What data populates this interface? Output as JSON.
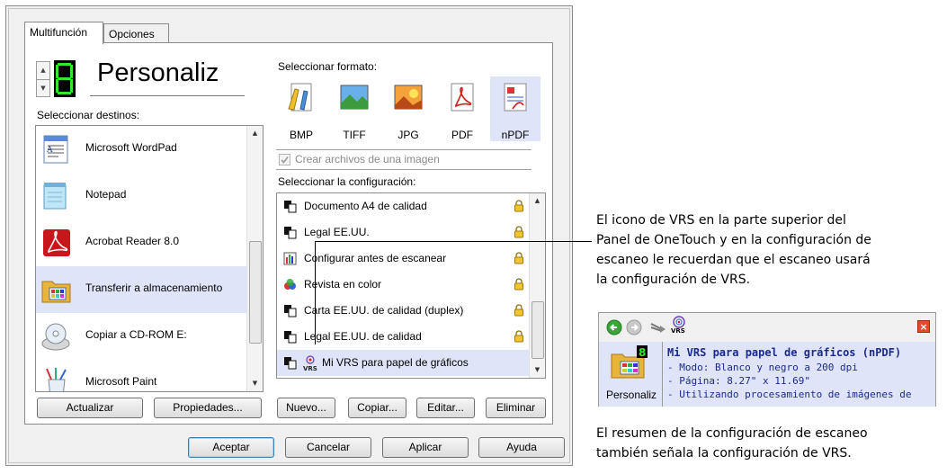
{
  "tabs": [
    {
      "label": "Multifunción",
      "active": true
    },
    {
      "label": "Opciones",
      "active": false
    }
  ],
  "profile": {
    "digit": "8",
    "name": "Personaliz"
  },
  "destinations": {
    "label": "Seleccionar destinos:",
    "items": [
      {
        "label": "Microsoft WordPad",
        "icon": "wordpad-icon"
      },
      {
        "label": "Notepad",
        "icon": "notepad-icon"
      },
      {
        "label": "Acrobat Reader 8.0",
        "icon": "acrobat-icon"
      },
      {
        "label": "Transferir a almacenamiento",
        "icon": "storage-folder-icon",
        "selected": true
      },
      {
        "label": "Copiar a CD-ROM  E:",
        "icon": "cdrom-icon"
      },
      {
        "label": "Microsoft Paint",
        "icon": "paint-icon"
      }
    ]
  },
  "formats": {
    "label": "Seleccionar formato:",
    "items": [
      {
        "label": "BMP",
        "icon": "bmp-icon"
      },
      {
        "label": "TIFF",
        "icon": "tiff-icon"
      },
      {
        "label": "JPG",
        "icon": "jpg-icon"
      },
      {
        "label": "PDF",
        "icon": "pdf-icon"
      },
      {
        "label": "nPDF",
        "icon": "npdf-icon",
        "selected": true
      }
    ],
    "single_image_label": "Crear archivos de una imagen",
    "single_image_checked": true
  },
  "configs": {
    "label": "Seleccionar la configuración:",
    "items": [
      {
        "label": "Documento A4 de calidad",
        "icon": "scan-config-icon",
        "locked": true
      },
      {
        "label": "Legal EE.UU.",
        "icon": "scan-config-icon",
        "locked": true
      },
      {
        "label": "Configurar antes de escanear",
        "icon": "configure-icon",
        "locked": true
      },
      {
        "label": "Revista en color",
        "icon": "color-magazine-icon",
        "locked": true
      },
      {
        "label": "Carta EE.UU. de calidad (duplex)",
        "icon": "scan-config-icon",
        "locked": true
      },
      {
        "label": "Legal EE.UU. de calidad",
        "icon": "scan-config-icon",
        "locked": true
      },
      {
        "label": "Mi VRS para papel de gráficos",
        "icon": "vrs-config-icon",
        "locked": false,
        "selected": true
      }
    ]
  },
  "left_buttons": {
    "refresh": "Actualizar",
    "properties": "Propiedades..."
  },
  "config_buttons": {
    "new": "Nuevo...",
    "copy": "Copiar...",
    "edit": "Editar...",
    "delete": "Eliminar"
  },
  "dialog_buttons": {
    "ok": "Aceptar",
    "cancel": "Cancelar",
    "apply": "Aplicar",
    "help": "Ayuda"
  },
  "notes": {
    "top": [
      "El icono de VRS en la parte superior del",
      "Panel de OneTouch y en la configuración de",
      "escaneo le recuerdan que el escaneo usará",
      "la configuración de VRS."
    ],
    "bottom": [
      "El resumen de la configuración de escaneo",
      "también señala la configuración de VRS."
    ]
  },
  "summary": {
    "vrs_badge": "VRS",
    "profile_label": "Personaliz",
    "title": "Mi VRS para papel de gráficos (nPDF)",
    "lines": [
      "- Modo: Blanco y negro a 200 dpi",
      "- Página:  8.27\" x 11.69\"",
      "- Utilizando procesamiento de imágenes de"
    ]
  },
  "colors": {
    "selection": "#dfe4f8",
    "summary_text": "#1a2a8f",
    "digit": "#36e336",
    "close": "#e04b2a"
  }
}
